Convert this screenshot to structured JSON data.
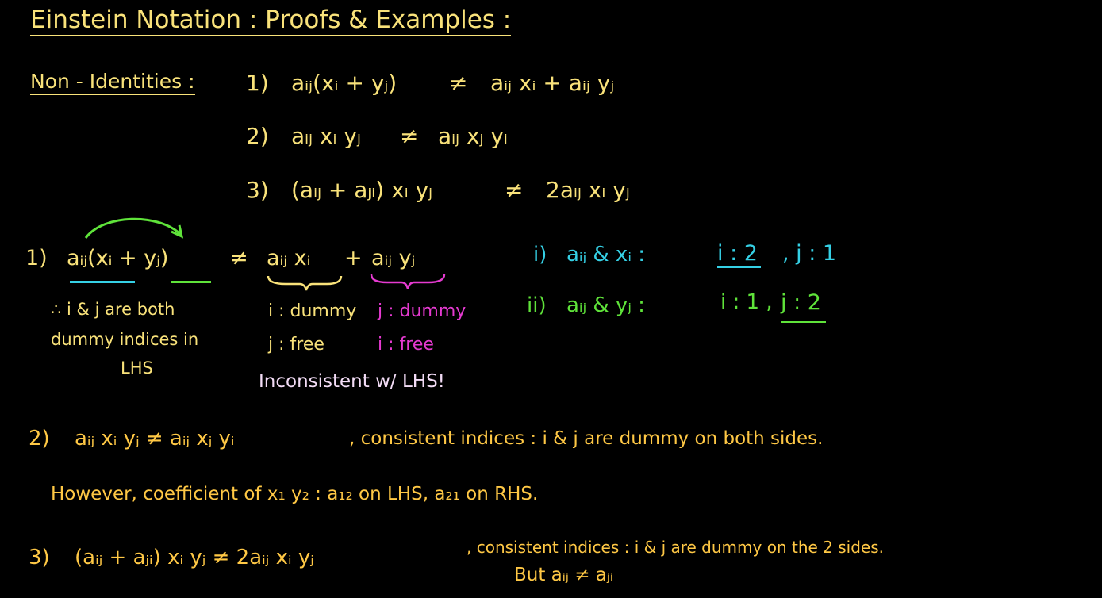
{
  "title": "Einstein Notation : Proofs & Examples :",
  "non_identities": {
    "label": "Non - Identities :",
    "items": [
      {
        "num": "1)",
        "lhs": "aᵢⱼ(xᵢ + yⱼ)",
        "op": "≠",
        "rhs": "aᵢⱼ xᵢ + aᵢⱼ yⱼ"
      },
      {
        "num": "2)",
        "lhs": "aᵢⱼ xᵢ yⱼ",
        "op": "≠",
        "rhs": "aᵢⱼ xⱼ yᵢ"
      },
      {
        "num": "3)",
        "lhs": "(aᵢⱼ + aⱼᵢ) xᵢ yⱼ",
        "op": "≠",
        "rhs": "2aᵢⱼ xᵢ yⱼ"
      }
    ]
  },
  "proof1": {
    "num": "1)",
    "lhs": "aᵢⱼ(xᵢ + yⱼ)",
    "op": "≠",
    "rhs_a": "aᵢⱼ xᵢ",
    "plus": "+",
    "rhs_b": "aᵢⱼ yⱼ",
    "lhs_note": [
      "∴ i & j are both",
      "dummy indices in",
      "LHS"
    ],
    "a_notes": [
      "i : dummy",
      "j : free"
    ],
    "b_notes": [
      "j : dummy",
      "i : free"
    ],
    "conclusion": "Inconsistent w/ LHS!",
    "sub_i": {
      "num": "i)",
      "text": "aᵢⱼ & xᵢ :",
      "i": "i : 2",
      "j": ", j : 1"
    },
    "sub_ii": {
      "num": "ii)",
      "text": "aᵢⱼ & yⱼ :",
      "i": "i : 1 ,",
      "j": "j : 2"
    }
  },
  "proof2": {
    "num": "2)",
    "eq": "aᵢⱼ xᵢ yⱼ ≠ aᵢⱼ xⱼ yᵢ",
    "note": ", consistent indices : i & j are dummy on both sides.",
    "line2": "However, coefficient of x₁ y₂ :   a₁₂ on LHS,  a₂₁ on RHS."
  },
  "proof3": {
    "num": "3)",
    "eq": "(aᵢⱼ + aⱼᵢ) xᵢ yⱼ ≠ 2aᵢⱼ xᵢ yⱼ",
    "note": ", consistent indices : i & j are dummy on the 2 sides.",
    "but": "But  aᵢⱼ ≠ aⱼᵢ"
  },
  "colors": {
    "background": "#000000",
    "yellow": "#f9e27a",
    "orange": "#ffc845",
    "cyan": "#35d0e5",
    "green": "#5fe33a",
    "magenta": "#e63ad1",
    "lavender": "#f3dcf6"
  }
}
